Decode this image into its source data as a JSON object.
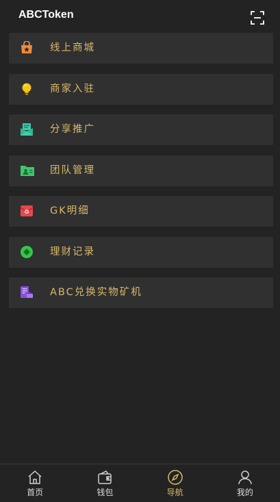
{
  "header": {
    "title": "ABCToken",
    "scan_icon": "scan-icon"
  },
  "menu": {
    "items": [
      {
        "label": "线上商城",
        "icon": "shop-bag-icon",
        "color": "#f08a3a"
      },
      {
        "label": "商家入驻",
        "icon": "lightbulb-icon",
        "color": "#f5c518"
      },
      {
        "label": "分享推广",
        "icon": "share-envelope-icon",
        "color": "#3ec9a7"
      },
      {
        "label": "团队管理",
        "icon": "team-folder-icon",
        "color": "#3cc86a"
      },
      {
        "label": "GK明细",
        "icon": "gk-detail-icon",
        "color": "#e8474c"
      },
      {
        "label": "理财记录",
        "icon": "finance-coin-icon",
        "color": "#32c84a"
      },
      {
        "label": "ABC兑换实物矿机",
        "icon": "exchange-doc-icon",
        "color": "#8a4fd8"
      }
    ]
  },
  "tabbar": {
    "tabs": [
      {
        "label": "首页",
        "icon": "home-icon"
      },
      {
        "label": "钱包",
        "icon": "wallet-icon"
      },
      {
        "label": "导航",
        "icon": "compass-icon",
        "active": true
      },
      {
        "label": "我的",
        "icon": "user-icon"
      }
    ]
  },
  "colors": {
    "background": "#232323",
    "card": "#303030",
    "accent": "#d9b96b"
  }
}
